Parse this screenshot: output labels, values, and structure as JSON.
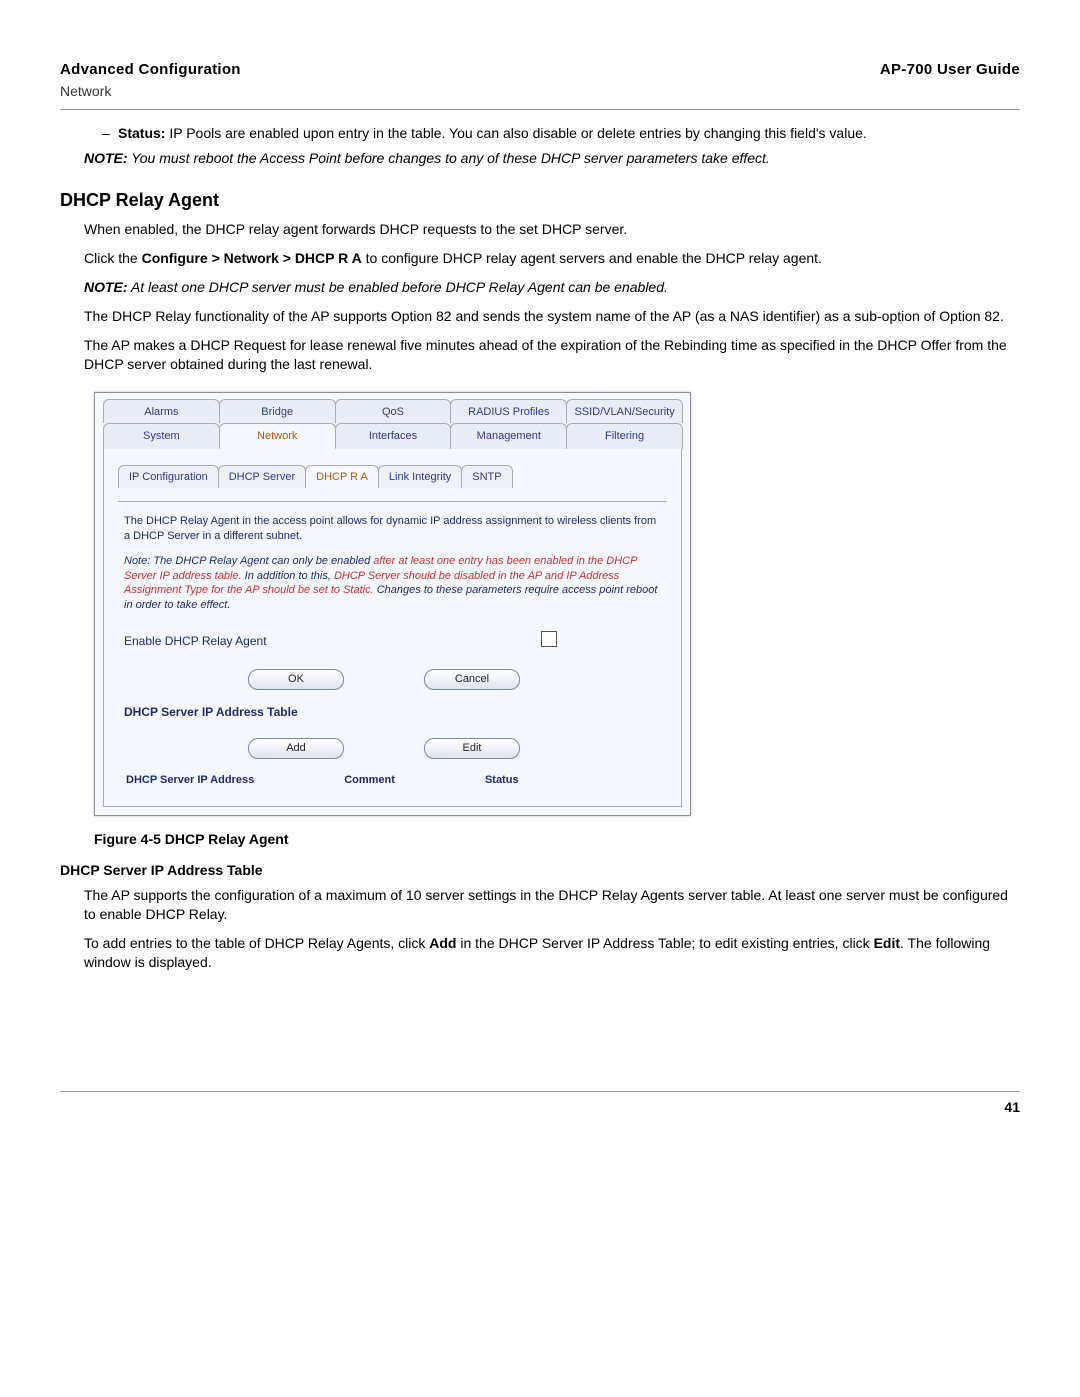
{
  "header": {
    "title_left": "Advanced Configuration",
    "sub_left": "Network",
    "title_right": "AP-700 User Guide"
  },
  "status_item": {
    "dash": "–",
    "label": "Status:",
    "text": " IP Pools are enabled upon entry in the table. You can also disable or delete entries by changing this field's value."
  },
  "note1": {
    "label": "NOTE:",
    "text": "  You must reboot the Access Point before changes to any of these DHCP server parameters take effect."
  },
  "section": {
    "heading": "DHCP Relay Agent",
    "p1": "When enabled, the DHCP relay agent forwards DHCP requests to the set DHCP server.",
    "p2_pre": "Click the ",
    "p2_bold": "Configure > Network > DHCP R A",
    "p2_post": " to configure DHCP relay agent servers and enable the DHCP relay agent.",
    "note2_label": "NOTE:",
    "note2_text": "  At least one DHCP server must be enabled before DHCP Relay Agent can be enabled.",
    "p3": "The DHCP Relay functionality of the AP supports Option 82 and sends the system name of the AP (as a NAS identifier) as a sub-option of Option 82.",
    "p4": "The AP makes a DHCP Request for lease renewal five minutes ahead of the expiration of the Rebinding time as specified in the DHCP Offer from the DHCP server obtained during the last renewal."
  },
  "shot": {
    "top_tabs": [
      "Alarms",
      "Bridge",
      "QoS",
      "RADIUS Profiles",
      "SSID/VLAN/Security"
    ],
    "main_tabs": [
      "System",
      "Network",
      "Interfaces",
      "Management",
      "Filtering"
    ],
    "main_selected": "Network",
    "sub_tabs": [
      "IP Configuration",
      "DHCP Server",
      "DHCP R A",
      "Link Integrity",
      "SNTP"
    ],
    "sub_selected": "DHCP R A",
    "desc": "The DHCP Relay Agent in the access point allows for dynamic IP address assignment to wireless clients from a DHCP Server in a different subnet.",
    "note_pre": "Note: The DHCP Relay Agent can only be enabled ",
    "note_warn1": "after at least one entry has been enabled in the DHCP Server IP address table.",
    "note_mid": " In addition to this, ",
    "note_warn2": "DHCP Server should be disabled in the AP and IP Address Assignment Type for the AP should be set to Static.",
    "note_post": " Changes to these parameters require access point reboot in order to take effect.",
    "enable_label": "Enable DHCP Relay Agent",
    "buttons": {
      "ok": "OK",
      "cancel": "Cancel",
      "add": "Add",
      "edit": "Edit"
    },
    "table_title": "DHCP Server IP Address Table",
    "cols": [
      "DHCP Server IP Address",
      "Comment",
      "Status"
    ]
  },
  "figure_caption": "Figure 4-5 DHCP Relay Agent",
  "subsection": {
    "heading": "DHCP Server IP Address Table",
    "p1": "The AP supports the configuration of a maximum of 10 server settings in the DHCP Relay Agents server table. At least one server must be configured to enable DHCP Relay.",
    "p2_pre": "To add entries to the table of DHCP Relay Agents, click ",
    "p2_b1": "Add",
    "p2_mid": " in the DHCP Server IP Address Table; to edit existing entries, click ",
    "p2_b2": "Edit",
    "p2_post": ". The following window is displayed."
  },
  "page_number": "41"
}
